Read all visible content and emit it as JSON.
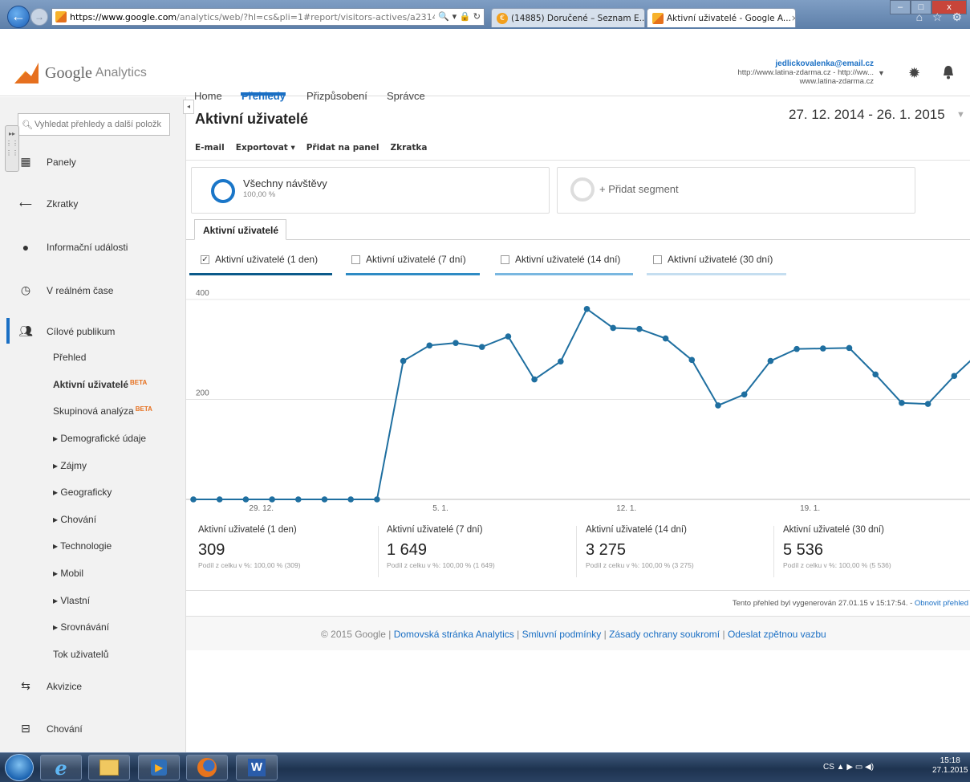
{
  "browser": {
    "url_host": "https://www.google.com",
    "url_path": "/analytics/web/?hl=cs&pli=1#report/visitors-actives/a231408w",
    "tabs": [
      {
        "label": "(14885) Doručené – Seznam E...",
        "icon_label": "€"
      },
      {
        "label": "Aktivní uživatelé - Google A...",
        "close": "×"
      }
    ],
    "address_icons": "🔍 ▾ 🔒 ↻",
    "right_icons": "⌂ ☆ ⚙",
    "window_controls": {
      "minimize": "–",
      "maximize": "□",
      "close": "x"
    }
  },
  "header": {
    "logo_google": "Google",
    "logo_analytics": "Analytics",
    "nav": {
      "home": "Home",
      "prehledy": "Přehledy",
      "prizpusobeni": "Přizpůsobení",
      "spravce": "Správce"
    },
    "account": {
      "email": "jedlickovalenka@email.cz",
      "line2": "http://www.latina-zdarma.cz - http://ww...",
      "line3": "www.latina-zdarma.cz"
    }
  },
  "sidebar": {
    "search_placeholder": "Vyhledat přehledy a další položk",
    "collapse_label": "◂",
    "items": {
      "panely": "Panely",
      "zkratky": "Zkratky",
      "informacni": "Informační události",
      "realnem": "V reálném čase",
      "cilove": "Cílové publikum",
      "akvizice": "Akvizice",
      "chovani": "Chování"
    },
    "sub": {
      "prehled": "Přehled",
      "aktivni": "Aktivní uživatelé",
      "skupinova": "Skupinová analýza",
      "demograficke": "▸ Demografické údaje",
      "zajmy": "▸ Zájmy",
      "geograficky": "▸ Geograficky",
      "chovani": "▸ Chování",
      "technologie": "▸ Technologie",
      "mobil": "▸ Mobil",
      "vlastni": "▸ Vlastní",
      "srovnavani": "▸ Srovnávání",
      "tok": "Tok uživatelů"
    },
    "beta": "BETA"
  },
  "report": {
    "title": "Aktivní uživatelé",
    "date_range": "27. 12. 2014 - 26. 1. 2015",
    "toolbar": {
      "email": "E-mail",
      "export": "Exportovat ▾",
      "add_panel": "Přidat na panel",
      "shortcut": "Zkratka"
    },
    "segment_all": {
      "label": "Všechny návštěvy",
      "pct": "100,00 %"
    },
    "segment_add": "+ Přidat segment",
    "tab": "Aktivní uživatelé",
    "metric_checks": [
      {
        "label": "Aktivní uživatelé (1 den)",
        "checked": "✓"
      },
      {
        "label": "Aktivní uživatelé (7 dní)",
        "checked": ""
      },
      {
        "label": "Aktivní uživatelé (14 dní)",
        "checked": ""
      },
      {
        "label": "Aktivní uživatelé (30 dní)",
        "checked": ""
      }
    ],
    "stats": [
      {
        "label": "Aktivní uživatelé (1 den)",
        "value": "309",
        "pct": "Podíl z celku v %: 100,00 % (309)"
      },
      {
        "label": "Aktivní uživatelé (7 dní)",
        "value": "1 649",
        "pct": "Podíl z celku v %: 100,00 % (1 649)"
      },
      {
        "label": "Aktivní uživatelé (14 dní)",
        "value": "3 275",
        "pct": "Podíl z celku v %: 100,00 % (3 275)"
      },
      {
        "label": "Aktivní uživatelé (30 dní)",
        "value": "5 536",
        "pct": "Podíl z celku v %: 100,00 % (5 536)"
      }
    ],
    "generated_text": "Tento přehled byl vygenerován 27.01.15 v 15:17:54. -",
    "generated_link": "Obnovit přehled",
    "footer": {
      "copyright": "© 2015 Google |",
      "link1": "Domovská stránka Analytics",
      "link2": "Smluvní podmínky",
      "link3": "Zásady ochrany soukromí",
      "link4": "Odeslat zpětnou vazbu",
      "sep": " | "
    }
  },
  "chart_data": {
    "type": "line",
    "series": [
      {
        "values": [
          0,
          0,
          0,
          0,
          0,
          0,
          0,
          0,
          277,
          308,
          313,
          305,
          326,
          240,
          276,
          381,
          343,
          341,
          322,
          279,
          188,
          210,
          277,
          301,
          302,
          303,
          250,
          193,
          191,
          247,
          296
        ]
      }
    ],
    "x_tick_labels": [
      {
        "index": 2,
        "label": "29. 12."
      },
      {
        "index": 9,
        "label": "5. 1."
      },
      {
        "index": 16,
        "label": "12. 1."
      },
      {
        "index": 23,
        "label": "19. 1."
      }
    ],
    "y_ticks": [
      200,
      400
    ],
    "ylim": [
      0,
      400
    ],
    "line_color": "#1f6fa0",
    "grid": true
  },
  "taskbar": {
    "word_label": "W",
    "tray": "CS  ▲  ▶  ▭  ◀)",
    "time": "15:18",
    "date": "27.1.2015"
  }
}
